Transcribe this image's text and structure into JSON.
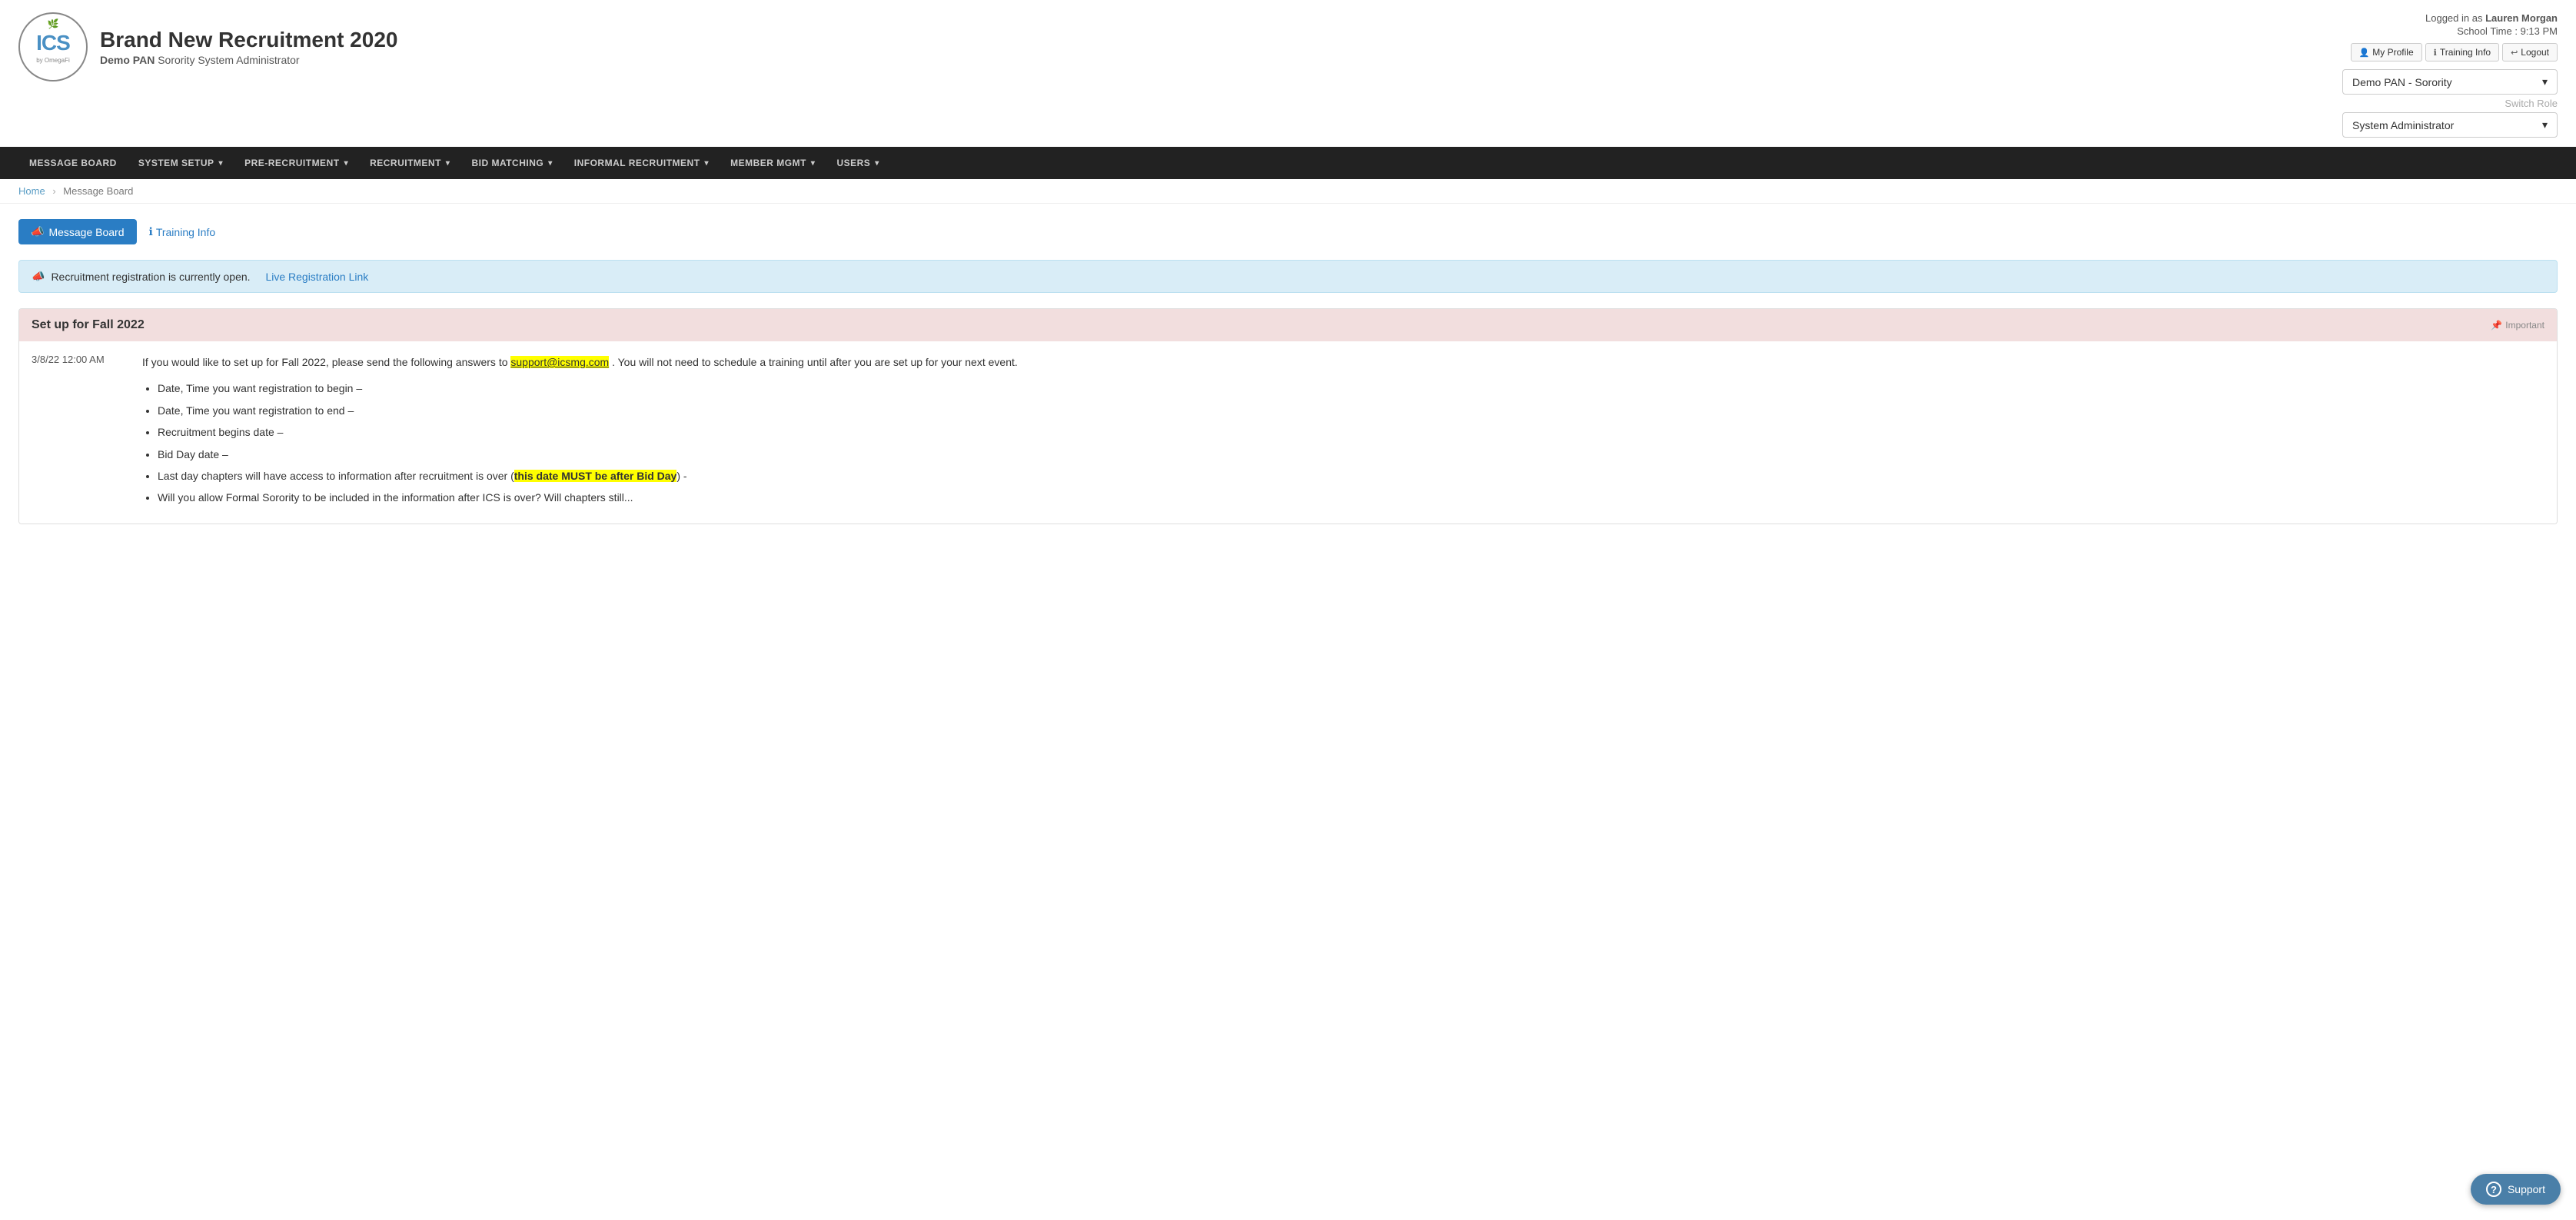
{
  "header": {
    "logo_text": "ICS",
    "logo_sub": "by OmegaFi",
    "title": "Brand New Recruitment 2020",
    "subtitle_org": "Demo PAN",
    "subtitle_role": "Sorority System Administrator",
    "logged_in_label": "Logged in as",
    "logged_in_user": "Lauren Morgan",
    "school_time_label": "School Time :",
    "school_time_value": "9:13 PM"
  },
  "header_buttons": [
    {
      "id": "my-profile",
      "icon": "👤",
      "label": "My Profile"
    },
    {
      "id": "training-info",
      "icon": "ℹ",
      "label": "Training Info"
    },
    {
      "id": "logout",
      "icon": "⏎",
      "label": "Logout"
    }
  ],
  "dropdowns": {
    "organization": {
      "selected": "Demo PAN - Sorority",
      "options": [
        "Demo PAN - Sorority"
      ]
    },
    "switch_role_label": "Switch Role",
    "role": {
      "selected": "System Administrator",
      "options": [
        "System Administrator"
      ]
    }
  },
  "navbar": {
    "items": [
      {
        "label": "MESSAGE BOARD",
        "has_dropdown": false
      },
      {
        "label": "SYSTEM SETUP",
        "has_dropdown": true
      },
      {
        "label": "PRE-RECRUITMENT",
        "has_dropdown": true
      },
      {
        "label": "RECRUITMENT",
        "has_dropdown": true
      },
      {
        "label": "BID MATCHING",
        "has_dropdown": true
      },
      {
        "label": "INFORMAL RECRUITMENT",
        "has_dropdown": true
      },
      {
        "label": "MEMBER MGMT",
        "has_dropdown": true
      },
      {
        "label": "USERS",
        "has_dropdown": true
      }
    ]
  },
  "breadcrumb": {
    "home": "Home",
    "separator": "›",
    "current": "Message Board"
  },
  "actions": {
    "message_board_btn": "Message Board",
    "training_info_link": "Training Info"
  },
  "registration_banner": {
    "icon": "📣",
    "text": "Recruitment registration is currently open.",
    "link_text": "Live Registration Link",
    "link_href": "#"
  },
  "message_board": {
    "title": "Set up for Fall 2022",
    "important_icon": "📌",
    "important_label": "Important",
    "date": "3/8/22 12:00 AM",
    "body_intro": "If you would like to set up for Fall 2022, please send the following answers to",
    "email": "support@icsmg.com",
    "body_after_email": ". You will not need to schedule a training until after you are set up for your next event.",
    "bullet_points": [
      "Date, Time you want registration to begin –",
      "Date, Time you want registration to end –",
      "Recruitment begins date –",
      "Bid Day date –",
      "Last day chapters will have access to information after recruitment is over (this date MUST be after Bid Day) -",
      "Will you allow Formal Sorority to be included in the information after ICS is over? Will chapters still..."
    ],
    "highlight_text": "this date MUST be after Bid Day"
  },
  "support": {
    "icon": "?",
    "label": "Support"
  }
}
